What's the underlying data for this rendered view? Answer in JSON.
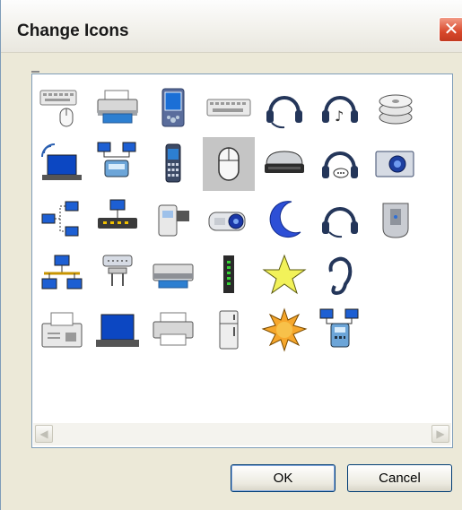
{
  "dialog": {
    "title": "Change Icons",
    "close_glyph": "✕",
    "ok_label": "OK",
    "cancel_label": "Cancel"
  },
  "scrollbar": {
    "left_glyph": "◀",
    "right_glyph": "▶"
  },
  "icons": {
    "selected": "mouse-icon",
    "rows": [
      [
        "keyboard-mouse-icon",
        "printer-icon",
        "pda-icon",
        "keyboard-icon",
        "headset-icon",
        "headphones-music-icon",
        "disc-stack-icon"
      ],
      [
        "wireless-laptop-icon",
        "network-phone-icon",
        "mobile-phone-icon",
        "mouse-icon",
        "disc-drive-icon",
        "headset-chat-icon",
        "camera-icon"
      ],
      [
        "network-connection-icon",
        "network-hub-icon",
        "camcorder-icon",
        "projector-icon",
        "moon-icon",
        "headset-mic-icon",
        "router-icon"
      ],
      [
        "network-tree-icon",
        "usb-plug-icon",
        "scanner-icon",
        "modem-icon",
        "star-icon",
        "ear-icon"
      ],
      [
        "fax-machine-icon",
        "laptop-icon",
        "desktop-printer-icon",
        "refrigerator-icon",
        "sun-icon",
        "networked-phone-icon"
      ]
    ]
  },
  "colors": {
    "window_bg": "#ece9d8",
    "panel_border": "#7f9db9",
    "selection": "#c5c5c5",
    "close_button": "#d8482b",
    "button_border": "#003c74"
  }
}
